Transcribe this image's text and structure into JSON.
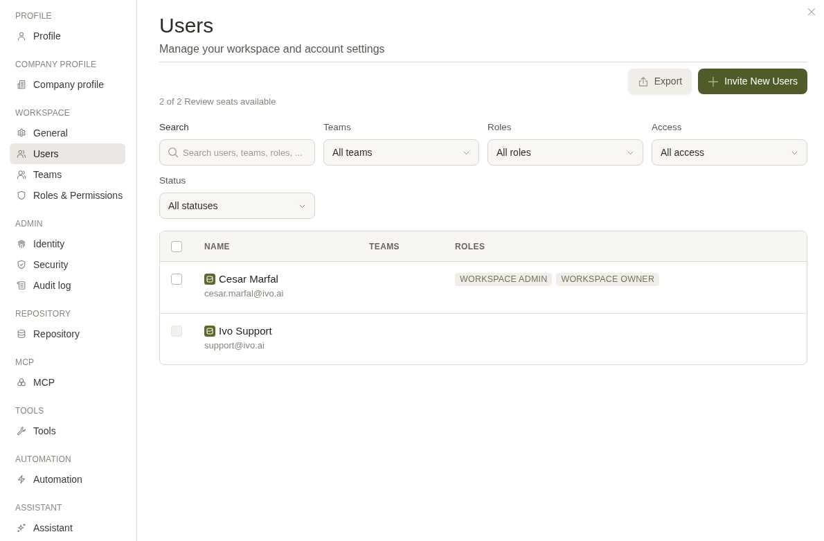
{
  "sidebar": {
    "sections": [
      {
        "heading": "PROFILE",
        "items": [
          {
            "label": "Profile",
            "selected": false
          }
        ]
      },
      {
        "heading": "COMPANY PROFILE",
        "items": [
          {
            "label": "Company profile",
            "selected": false
          }
        ]
      },
      {
        "heading": "WORKSPACE",
        "items": [
          {
            "label": "General",
            "selected": false
          },
          {
            "label": "Users",
            "selected": true
          },
          {
            "label": "Teams",
            "selected": false
          },
          {
            "label": "Roles & Permissions",
            "selected": false
          }
        ]
      },
      {
        "heading": "ADMIN",
        "items": [
          {
            "label": "Identity",
            "selected": false
          },
          {
            "label": "Security",
            "selected": false
          },
          {
            "label": "Audit log",
            "selected": false
          }
        ]
      },
      {
        "heading": "REPOSITORY",
        "items": [
          {
            "label": "Repository",
            "selected": false
          }
        ]
      },
      {
        "heading": "MCP",
        "items": [
          {
            "label": "MCP",
            "selected": false
          }
        ]
      },
      {
        "heading": "TOOLS",
        "items": [
          {
            "label": "Tools",
            "selected": false
          }
        ]
      },
      {
        "heading": "AUTOMATION",
        "items": [
          {
            "label": "Automation",
            "selected": false
          }
        ]
      },
      {
        "heading": "ASSISTANT",
        "items": [
          {
            "label": "Assistant",
            "selected": false
          }
        ]
      }
    ]
  },
  "header": {
    "title": "Users",
    "subtitle": "Manage your workspace and account settings"
  },
  "actions": [
    {
      "label": "Export",
      "kind": "secondary"
    },
    {
      "label": "Invite New Users",
      "kind": "primary"
    }
  ],
  "seats_note": "2 of 2 Review seats available",
  "filters": [
    {
      "label": "Search",
      "kind": "search",
      "placeholder": "Search users, teams, roles, ..."
    },
    {
      "label": "Teams",
      "kind": "select",
      "value": "All teams"
    },
    {
      "label": "Roles",
      "kind": "select",
      "value": "All roles"
    },
    {
      "label": "Access",
      "kind": "select",
      "value": "All access"
    },
    {
      "label": "Status",
      "kind": "select",
      "value": "All statuses"
    }
  ],
  "table": {
    "header_checkbox": {
      "checked": false
    },
    "columns": [
      "NAME",
      "TEAMS",
      "ROLES"
    ],
    "rows": [
      {
        "checked": false,
        "disabled": false,
        "name": "Cesar Marfal",
        "email": "cesar.marfal@ivo.ai",
        "roles": [
          "WORKSPACE ADMIN",
          "WORKSPACE OWNER"
        ]
      },
      {
        "checked": false,
        "disabled": true,
        "name": "Ivo Support",
        "email": "support@ivo.ai"
      }
    ]
  }
}
